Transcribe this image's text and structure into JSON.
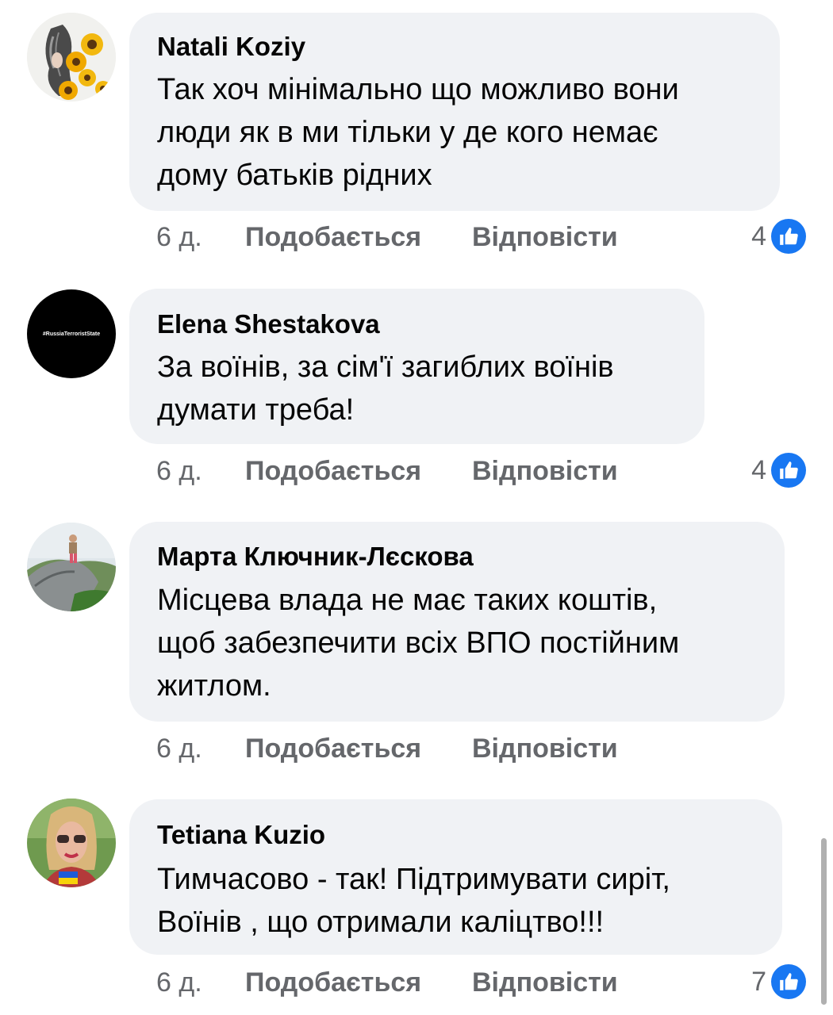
{
  "comments": [
    {
      "author": "Natali Koziy",
      "text": "Так хоч мінімально що можливо вони\nлюди як в ми тільки у де кого немає\nдому батьків рідних",
      "time": "6 д.",
      "like_label": "Подобається",
      "reply_label": "Відповісти",
      "reactions": "4",
      "reaction_icon": "like-icon"
    },
    {
      "author": "Elena Shestakova",
      "avatar_text": "#RussiaTerroristState",
      "text": "За воїнів, за сім'ї загиблих воїнів\nдумати треба!",
      "time": "6 д.",
      "like_label": "Подобається",
      "reply_label": "Відповісти",
      "reactions": "4",
      "reaction_icon": "like-icon"
    },
    {
      "author": "Марта Ключник-Лєскова",
      "text": "Місцева влада не має таких коштів,\nщоб забезпечити всіх ВПО постійним\nжитлом.",
      "time": "6 д.",
      "like_label": "Подобається",
      "reply_label": "Відповісти"
    },
    {
      "author": "Tetiana Kuzio",
      "text": "Тимчасово - так! Підтримувати сиріт,\nВоїнів , що отримали каліцтво!!!",
      "time": "6 д.",
      "like_label": "Подобається",
      "reply_label": "Відповісти",
      "reactions": "7",
      "reaction_icon": "like-icon"
    }
  ],
  "colors": {
    "bubble": "#f0f2f5",
    "meta_text": "#65676b",
    "like_blue": "#1877f2"
  }
}
